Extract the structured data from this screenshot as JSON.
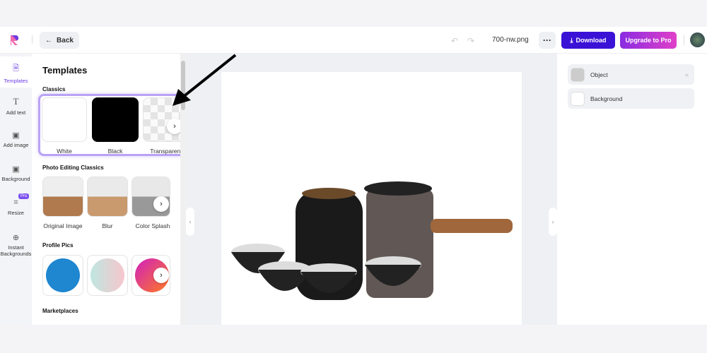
{
  "header": {
    "back_label": "Back",
    "file_name": "700-nw.png",
    "more_label": "···",
    "download_label": "Download",
    "upgrade_label": "Upgrade to Pro"
  },
  "rail": {
    "items": [
      {
        "label": "Templates",
        "icon": "template-icon",
        "active": true
      },
      {
        "label": "Add text",
        "icon": "text-icon"
      },
      {
        "label": "Add image",
        "icon": "image-icon"
      },
      {
        "label": "Background",
        "icon": "background-icon"
      },
      {
        "label": "Resize",
        "icon": "crop-icon",
        "badge": "Pro"
      },
      {
        "label": "Instant Backgrounds",
        "icon": "plus-icon"
      }
    ]
  },
  "panel": {
    "title": "Templates",
    "sections": [
      {
        "title": "Classics",
        "items": [
          "White",
          "Black",
          "Transparent"
        ]
      },
      {
        "title": "Photo Editing Classics",
        "items": [
          "Original Image",
          "Blur",
          "Color Splash"
        ]
      },
      {
        "title": "Profile Pics"
      },
      {
        "title": "Marketplaces"
      }
    ]
  },
  "layers": [
    {
      "label": "Object"
    },
    {
      "label": "Background"
    }
  ],
  "colors": {
    "accent": "#6a3de8",
    "download": "#3a12d6",
    "highlight": "#b9a3f5"
  }
}
